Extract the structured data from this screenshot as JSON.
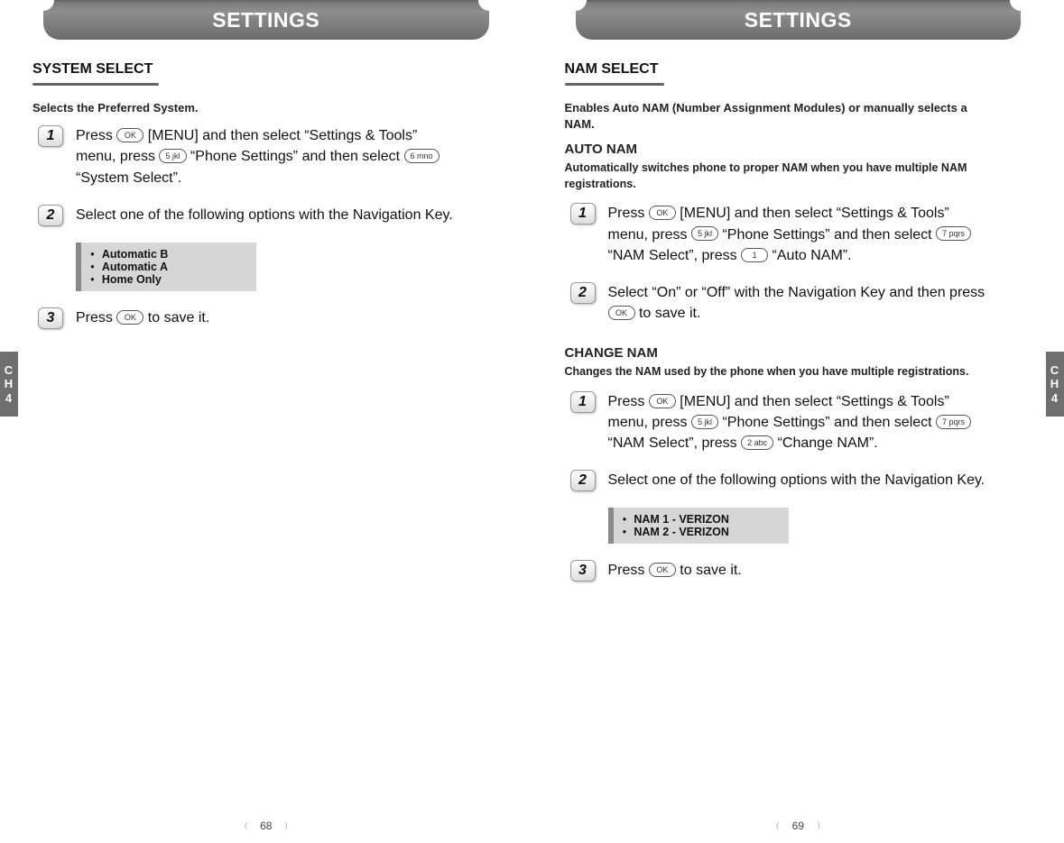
{
  "left": {
    "header": "SETTINGS",
    "side_tab_line1": "C",
    "side_tab_line2": "H",
    "side_tab_line3": "4",
    "page_number": "68",
    "section": {
      "title": "SYSTEM SELECT",
      "desc": "Selects the Preferred System.",
      "steps": [
        {
          "num": "1",
          "text_a": "Press ",
          "key_a": "OK",
          "text_b": " [MENU] and then select “Settings & Tools” menu, press ",
          "key_b": "5 jkl",
          "text_c": " “Phone Settings” and then select ",
          "key_c": "6 mno",
          "text_d": " “System Select”."
        },
        {
          "num": "2",
          "text_a": "Select one of the following options with the Navigation Key."
        },
        {
          "num": "3",
          "text_a": "Press ",
          "key_a": "OK",
          "text_b": " to save it."
        }
      ],
      "options": [
        "Automatic B",
        "Automatic A",
        "Home Only"
      ]
    }
  },
  "right": {
    "header": "SETTINGS",
    "side_tab_line1": "C",
    "side_tab_line2": "H",
    "side_tab_line3": "4",
    "page_number": "69",
    "section_title": "NAM SELECT",
    "section_desc": "Enables Auto NAM (Number Assignment Modules) or manually selects a NAM.",
    "auto_nam": {
      "title": "AUTO NAM",
      "desc": "Automatically switches phone to proper NAM when you have multiple NAM registrations.",
      "steps": [
        {
          "num": "1",
          "text_a": "Press ",
          "key_a": "OK",
          "text_b": " [MENU] and then select “Settings & Tools” menu, press ",
          "key_b": "5 jkl",
          "text_c": " “Phone Settings” and then select ",
          "key_c": "7 pqrs",
          "text_d": " “NAM Select”, press ",
          "key_d": "1",
          "text_e": " “Auto NAM”."
        },
        {
          "num": "2",
          "text_a": "Select “On” or “Off” with the Navigation Key and then press ",
          "key_a": "OK",
          "text_b": " to save it."
        }
      ]
    },
    "change_nam": {
      "title": "CHANGE NAM",
      "desc": "Changes the NAM used by the phone when you have multiple registrations.",
      "steps": [
        {
          "num": "1",
          "text_a": "Press ",
          "key_a": "OK",
          "text_b": " [MENU] and then select “Settings & Tools” menu, press ",
          "key_b": "5 jkl",
          "text_c": " “Phone Settings” and then select ",
          "key_c": "7 pqrs",
          "text_d": " “NAM Select”, press ",
          "key_d": "2 abc",
          "text_e": " “Change NAM”."
        },
        {
          "num": "2",
          "text_a": "Select one of the following options with the Navigation Key."
        },
        {
          "num": "3",
          "text_a": "Press ",
          "key_a": "OK",
          "text_b": " to save it."
        }
      ],
      "options": [
        "NAM 1 - VERIZON",
        "NAM 2 - VERIZON"
      ]
    }
  }
}
